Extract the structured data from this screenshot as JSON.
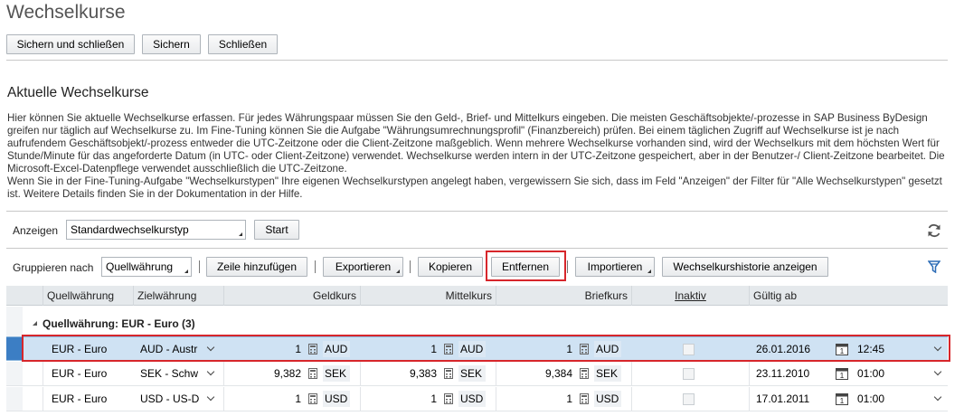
{
  "page": {
    "title": "Wechselkurse"
  },
  "toolbar": {
    "save_close": "Sichern und schließen",
    "save": "Sichern",
    "close": "Schließen"
  },
  "section": {
    "title": "Aktuelle Wechselkurse",
    "description_1": "Hier können Sie aktuelle Wechselkurse erfassen. Für jedes Währungspaar müssen Sie den Geld-, Brief- und Mittelkurs eingeben. Die meisten Geschäftsobjekte/-prozesse in SAP Business ByDesign greifen nur täglich auf Wechselkurse zu. Im Fine-Tuning können Sie die Aufgabe \"Währungsumrechnungsprofil\" (Finanzbereich) prüfen. Bei einem täglichen Zugriff auf Wechselkurse ist je nach aufrufendem Geschäftsobjekt/-prozess entweder die UTC-Zeitzone oder die Client-Zeitzone maßgeblich. Wenn mehrere Wechselkurse vorhanden sind, wird der Wechselkurs mit dem höchsten Wert für Stunde/Minute für das angeforderte Datum (in UTC- oder Client-Zeitzone) verwendet. Wechselkurse werden intern in der UTC-Zeitzone gespeichert, aber in der Benutzer-/ Client-Zeitzone bearbeitet. Die Microsoft-Excel-Datenpflege verwendet ausschließlich die UTC-Zeitzone.",
    "description_2": "Wenn Sie in der Fine-Tuning-Aufgabe \"Wechselkurstypen\" Ihre eigenen Wechselkurstypen angelegt haben, vergewissern Sie sich, dass im Feld \"Anzeigen\" der Filter für \"Alle Wechselkurstypen\" gesetzt ist. Weitere Details finden Sie in der Dokumentation in der Hilfe."
  },
  "filter": {
    "show_label": "Anzeigen",
    "show_value": "Standardwechselkurstyp",
    "start": "Start",
    "refresh_icon": "refresh-icon"
  },
  "actions": {
    "group_label": "Gruppieren nach",
    "group_value": "Quellwährung",
    "add_row": "Zeile hinzufügen",
    "export": "Exportieren",
    "copy": "Kopieren",
    "remove": "Entfernen",
    "import": "Importieren",
    "history": "Wechselkurshistorie anzeigen",
    "filter_icon": "filter-icon"
  },
  "table": {
    "headers": {
      "source": "Quellwährung",
      "target": "Zielwährung",
      "bid": "Geldkurs",
      "mid": "Mittelkurs",
      "ask": "Briefkurs",
      "inactive": "Inaktiv",
      "valid_from": "Gültig ab"
    },
    "group_title": "Quellwährung: EUR - Euro (3)",
    "rows": [
      {
        "source": "EUR - Euro",
        "target": "AUD - Austr",
        "bid": "1",
        "bid_cur": "AUD",
        "mid": "1",
        "mid_cur": "AUD",
        "ask": "1",
        "ask_cur": "AUD",
        "date": "26.01.2016",
        "time": "12:45",
        "selected": true
      },
      {
        "source": "EUR - Euro",
        "target": "SEK - Schw",
        "bid": "9,382",
        "bid_cur": "SEK",
        "mid": "9,383",
        "mid_cur": "SEK",
        "ask": "9,384",
        "ask_cur": "SEK",
        "date": "23.11.2010",
        "time": "01:00",
        "selected": false
      },
      {
        "source": "EUR - Euro",
        "target": "USD - US-D",
        "bid": "1",
        "bid_cur": "USD",
        "mid": "1",
        "mid_cur": "USD",
        "ask": "1",
        "ask_cur": "USD",
        "date": "17.01.2011",
        "time": "01:00",
        "selected": false
      }
    ]
  },
  "colors": {
    "highlight": "#d7262b",
    "selection": "#cfe2f3",
    "selection_bar": "#3c7ec4"
  }
}
